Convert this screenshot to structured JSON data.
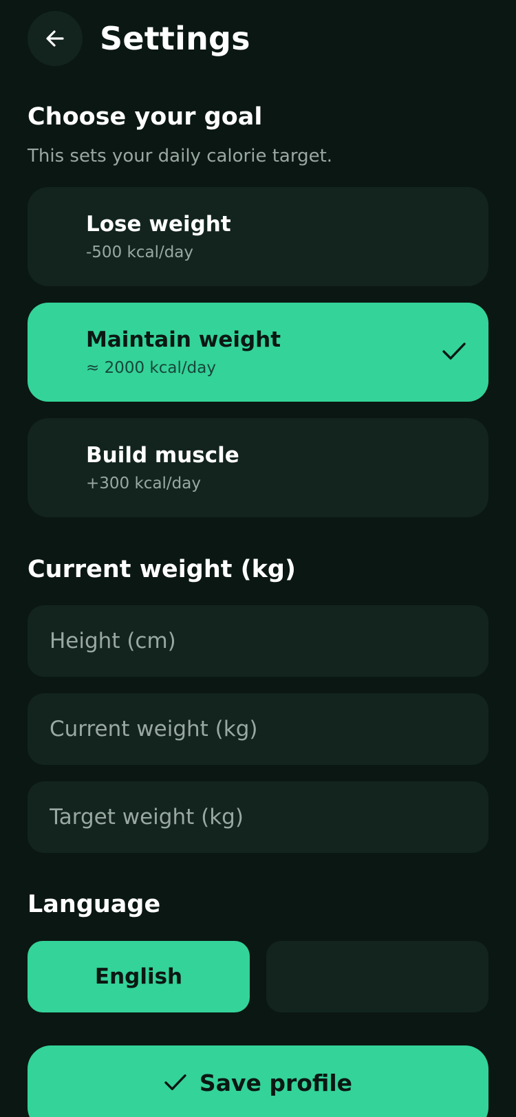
{
  "header": {
    "title": "Settings",
    "back_icon": "arrow-left-icon"
  },
  "goal_section": {
    "title": "Choose your goal",
    "subtitle": "This sets your daily calorie target.",
    "options": [
      {
        "label": "Lose weight",
        "kcal": "-500 kcal/day",
        "selected": false
      },
      {
        "label": "Maintain weight",
        "kcal": "≈ 2000 kcal/day",
        "selected": true
      },
      {
        "label": "Build muscle",
        "kcal": "+300 kcal/day",
        "selected": false
      }
    ]
  },
  "weight_section": {
    "title": "Current weight (kg)",
    "fields": [
      {
        "placeholder": "Height (cm)",
        "value": ""
      },
      {
        "placeholder": "Current weight (kg)",
        "value": ""
      },
      {
        "placeholder": "Target weight (kg)",
        "value": ""
      }
    ]
  },
  "language_section": {
    "title": "Language",
    "options": [
      {
        "label": "English",
        "active": true
      },
      {
        "label": "",
        "active": false
      }
    ]
  },
  "save_button": {
    "label": "Save profile",
    "icon": "check-icon"
  },
  "colors": {
    "background": "#0b1713",
    "card": "#13241e",
    "accent": "#34d399",
    "muted_text": "#9aa8a2"
  }
}
